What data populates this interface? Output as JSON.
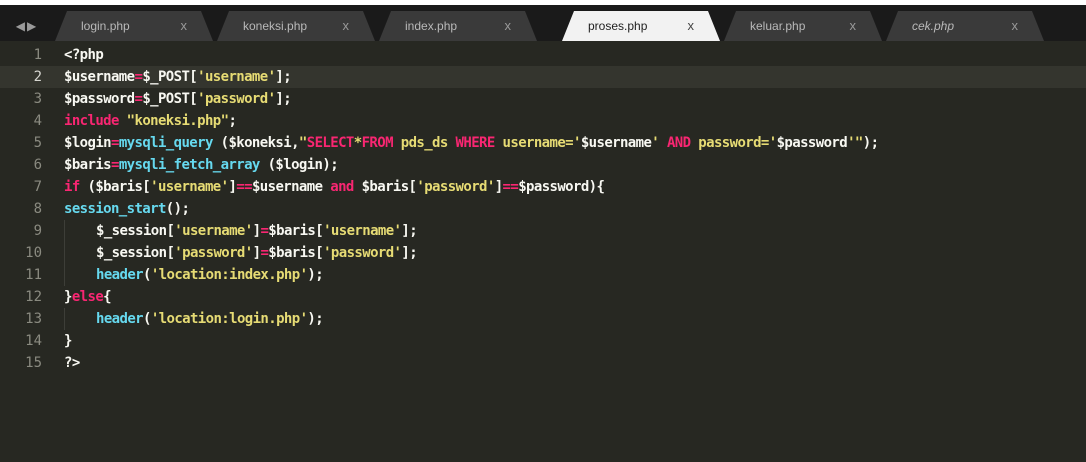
{
  "tabs": [
    {
      "label": "login.php",
      "close": "x",
      "active": false,
      "italic": false
    },
    {
      "label": "koneksi.php",
      "close": "x",
      "active": false,
      "italic": false
    },
    {
      "label": "index.php",
      "close": "x",
      "active": false,
      "italic": false
    },
    {
      "label": "proses.php",
      "close": "x",
      "active": true,
      "italic": false
    },
    {
      "label": "keluar.php",
      "close": "x",
      "active": false,
      "italic": false
    },
    {
      "label": "cek.php",
      "close": "x",
      "active": false,
      "italic": true
    }
  ],
  "nav": {
    "left": "◀",
    "right": "▶"
  },
  "current_line": 2,
  "colors": {
    "background": "#272822",
    "keyword": "#f92672",
    "string": "#e6db74",
    "function": "#66d9ef",
    "text": "#f8f8f2"
  },
  "lines": [
    {
      "n": "1",
      "t": [
        [
          "w",
          "<?php"
        ]
      ]
    },
    {
      "n": "2",
      "t": [
        [
          "w",
          "$username"
        ],
        [
          "k",
          "="
        ],
        [
          "w",
          "$_POST["
        ],
        [
          "s",
          "'username'"
        ],
        [
          "w",
          "];"
        ]
      ]
    },
    {
      "n": "3",
      "t": [
        [
          "w",
          "$password"
        ],
        [
          "k",
          "="
        ],
        [
          "w",
          "$_POST["
        ],
        [
          "s",
          "'password'"
        ],
        [
          "w",
          "];"
        ]
      ]
    },
    {
      "n": "4",
      "t": [
        [
          "k",
          "include"
        ],
        [
          "w",
          " "
        ],
        [
          "s",
          "\"koneksi.php\""
        ],
        [
          "w",
          ";"
        ]
      ]
    },
    {
      "n": "5",
      "t": [
        [
          "w",
          "$login"
        ],
        [
          "k",
          "="
        ],
        [
          "f",
          "mysqli_query"
        ],
        [
          "w",
          " ($koneksi,"
        ],
        [
          "s",
          "\""
        ],
        [
          "k",
          "SELECT"
        ],
        [
          "s",
          "*"
        ],
        [
          "k",
          "FROM"
        ],
        [
          "s",
          " pds_ds "
        ],
        [
          "k",
          "WHERE"
        ],
        [
          "s",
          " username='"
        ],
        [
          "w",
          "$username"
        ],
        [
          "s",
          "' "
        ],
        [
          "k",
          "AND"
        ],
        [
          "s",
          " password='"
        ],
        [
          "w",
          "$password"
        ],
        [
          "s",
          "'\""
        ],
        [
          "w",
          ");"
        ]
      ]
    },
    {
      "n": "6",
      "t": [
        [
          "w",
          "$baris"
        ],
        [
          "k",
          "="
        ],
        [
          "f",
          "mysqli_fetch_array"
        ],
        [
          "w",
          " ($login);"
        ]
      ]
    },
    {
      "n": "7",
      "t": [
        [
          "k",
          "if"
        ],
        [
          "w",
          " ($baris["
        ],
        [
          "s",
          "'username'"
        ],
        [
          "w",
          "]"
        ],
        [
          "k",
          "=="
        ],
        [
          "w",
          "$username "
        ],
        [
          "k",
          "and"
        ],
        [
          "w",
          " $baris["
        ],
        [
          "s",
          "'password'"
        ],
        [
          "w",
          "]"
        ],
        [
          "k",
          "=="
        ],
        [
          "w",
          "$password){"
        ]
      ]
    },
    {
      "n": "8",
      "t": [
        [
          "f",
          "session_start"
        ],
        [
          "w",
          "();"
        ]
      ]
    },
    {
      "n": "9",
      "i": 1,
      "t": [
        [
          "w",
          "$_session["
        ],
        [
          "s",
          "'username'"
        ],
        [
          "w",
          "]"
        ],
        [
          "k",
          "="
        ],
        [
          "w",
          "$baris["
        ],
        [
          "s",
          "'username'"
        ],
        [
          "w",
          "];"
        ]
      ]
    },
    {
      "n": "10",
      "i": 1,
      "t": [
        [
          "w",
          "$_session["
        ],
        [
          "s",
          "'password'"
        ],
        [
          "w",
          "]"
        ],
        [
          "k",
          "="
        ],
        [
          "w",
          "$baris["
        ],
        [
          "s",
          "'password'"
        ],
        [
          "w",
          "];"
        ]
      ]
    },
    {
      "n": "11",
      "i": 1,
      "t": [
        [
          "f",
          "header"
        ],
        [
          "w",
          "("
        ],
        [
          "s",
          "'location:index.php'"
        ],
        [
          "w",
          ");"
        ]
      ]
    },
    {
      "n": "12",
      "t": [
        [
          "w",
          "}"
        ],
        [
          "k",
          "else"
        ],
        [
          "w",
          "{"
        ]
      ]
    },
    {
      "n": "13",
      "i": 1,
      "t": [
        [
          "f",
          "header"
        ],
        [
          "w",
          "("
        ],
        [
          "s",
          "'location:login.php'"
        ],
        [
          "w",
          ");"
        ]
      ]
    },
    {
      "n": "14",
      "t": [
        [
          "w",
          "}"
        ]
      ]
    },
    {
      "n": "15",
      "t": [
        [
          "w",
          "?>"
        ]
      ]
    }
  ]
}
